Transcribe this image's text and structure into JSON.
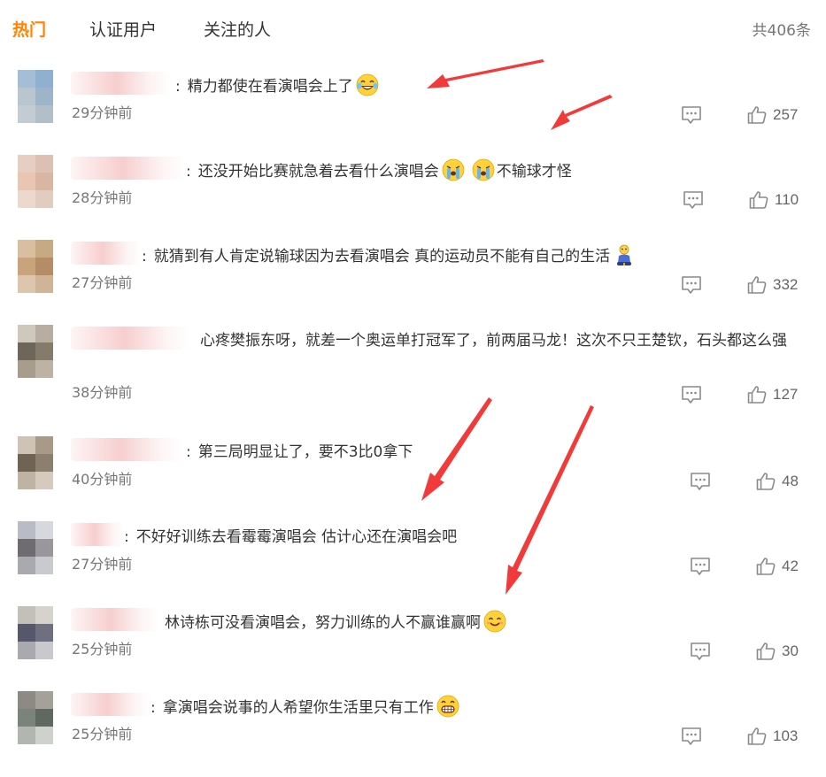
{
  "tabs": [
    {
      "label": "热门",
      "active": true
    },
    {
      "label": "认证用户",
      "active": false
    },
    {
      "label": "关注的人",
      "active": false
    }
  ],
  "total_count": "共406条",
  "colors": {
    "accent": "#ff8200",
    "text": "#333333",
    "meta": "#777777",
    "arrow": "#f23a3a"
  },
  "comments": [
    {
      "text": "精力都使在看演唱会上了",
      "emoji": "laughing-tears",
      "time": "29分钟前",
      "likes": "257"
    },
    {
      "text": "还没开始比赛就急着去看什么演唱会",
      "emoji": "crying",
      "emoji2": "crying",
      "text2": "不输球才怪",
      "time": "28分钟前",
      "likes": "110"
    },
    {
      "text": "就猜到有人肯定说输球因为去看演唱会 真的运动员不能有自己的生活",
      "emoji": "sitting-figure",
      "time": "27分钟前",
      "likes": "332"
    },
    {
      "text": "心疼樊振东呀，就差一个奥运单打冠军了，前两届马龙！这次不只王楚钦，石头都这么强",
      "time": "38分钟前",
      "likes": "127"
    },
    {
      "text": "第三局明显让了，要不3比0拿下",
      "time": "40分钟前",
      "likes": "48"
    },
    {
      "text": "不好好训练去看霉霉演唱会 估计心还在演唱会吧",
      "time": "27分钟前",
      "likes": "42"
    },
    {
      "text": "林诗栋可没看演唱会，努力训练的人不赢谁赢啊",
      "emoji": "smile",
      "time": "25分钟前",
      "likes": "30"
    },
    {
      "text": "拿演唱会说事的人希望你生活里只有工作",
      "emoji": "grin",
      "time": "25分钟前",
      "likes": "103"
    }
  ],
  "icons": {
    "reply": "comment-icon",
    "like": "thumbs-up-icon"
  }
}
